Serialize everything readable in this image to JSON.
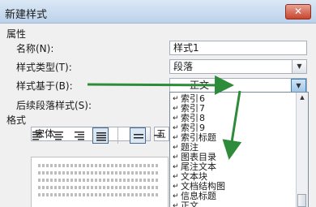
{
  "dialog": {
    "title": "新建样式",
    "close_glyph": "✕"
  },
  "properties": {
    "section_label": "属性",
    "name_label": "名称(N):",
    "name_value": "样式1",
    "type_label": "样式类型(T):",
    "type_value": "段落",
    "based_on_label": "样式基于(B):",
    "based_on_value": "正文",
    "following_label": "后续段落样式(S):"
  },
  "format": {
    "section_label": "格式",
    "font_value": "宋体",
    "size_value": "五"
  },
  "based_on_list": {
    "items": [
      {
        "mark": "↵",
        "name": "索引",
        "num": "6"
      },
      {
        "mark": "↵",
        "name": "索引",
        "num": "7"
      },
      {
        "mark": "↵",
        "name": "索引",
        "num": "8"
      },
      {
        "mark": "↵",
        "name": "索引",
        "num": "9"
      },
      {
        "mark": "↵",
        "name": "索引标题",
        "num": ""
      },
      {
        "mark": "↵",
        "name": "题注",
        "num": ""
      },
      {
        "mark": "↵",
        "name": "图表目录",
        "num": ""
      },
      {
        "mark": "↵",
        "name": "尾注文本",
        "num": ""
      },
      {
        "mark": "↵",
        "name": "文本块",
        "num": ""
      },
      {
        "mark": "↵",
        "name": "文档结构图",
        "num": ""
      },
      {
        "mark": "↵",
        "name": "信息标题",
        "num": ""
      },
      {
        "mark": "↵",
        "name": "正文",
        "num": ""
      }
    ]
  },
  "annotation": {
    "arrow_color": "#2e8b3a"
  }
}
